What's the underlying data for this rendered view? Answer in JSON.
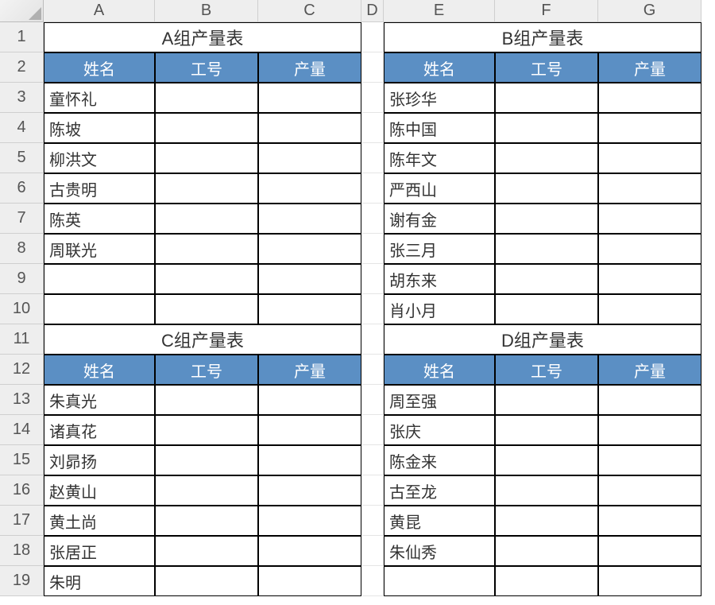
{
  "columns": [
    "A",
    "B",
    "C",
    "D",
    "E",
    "F",
    "G"
  ],
  "rows": [
    "1",
    "2",
    "3",
    "4",
    "5",
    "6",
    "7",
    "8",
    "9",
    "10",
    "11",
    "12",
    "13",
    "14",
    "15",
    "16",
    "17",
    "18",
    "19"
  ],
  "tables": {
    "A": {
      "title": "A组产量表",
      "headers": [
        "姓名",
        "工号",
        "产量"
      ],
      "names": [
        "童怀礼",
        "陈坡",
        "柳洪文",
        "古贵明",
        "陈英",
        "周联光",
        "",
        ""
      ]
    },
    "B": {
      "title": "B组产量表",
      "headers": [
        "姓名",
        "工号",
        "产量"
      ],
      "names": [
        "张珍华",
        "陈中国",
        "陈年文",
        "严西山",
        "谢有金",
        "张三月",
        "胡东来",
        "肖小月"
      ]
    },
    "C": {
      "title": "C组产量表",
      "headers": [
        "姓名",
        "工号",
        "产量"
      ],
      "names": [
        "朱真光",
        "诸真花",
        "刘昴扬",
        "赵黄山",
        "黄土尚",
        "张居正",
        "朱明"
      ]
    },
    "D": {
      "title": "D组产量表",
      "headers": [
        "姓名",
        "工号",
        "产量"
      ],
      "names": [
        "周至强",
        "张庆",
        "陈金来",
        "古至龙",
        "黄昆",
        "朱仙秀",
        ""
      ]
    }
  }
}
